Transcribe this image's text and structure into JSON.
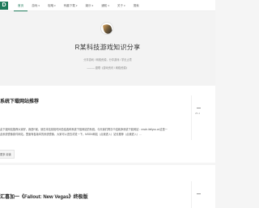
{
  "nav": {
    "logo": "D",
    "items": [
      {
        "label": "首页",
        "active": true
      },
      {
        "label": "游戏",
        "dropdown": true
      },
      {
        "label": "攻略",
        "dropdown": true
      },
      {
        "label": "有趣下载",
        "dropdown": true
      },
      {
        "label": "娱乐",
        "dropdown": true
      },
      {
        "label": "通知",
        "dropdown": true
      },
      {
        "label": "关于",
        "dropdown": true
      },
      {
        "label": "搜索"
      }
    ]
  },
  "hero": {
    "title": "R某科技游戏知识分享",
    "description": "分享游戏 / 网络资源，分享游戏 / 学无止境",
    "subtitle": "——— 题联《游戏资讯 / 网络资源》"
  },
  "articles": [
    {
      "title": "系统下载网站推荐",
      "excerpt_line1": "此下载网站推荐大家好，我是R某，就在本站前段时间总结各种系统下载网站的系统，今天我们再次介绍纯净系统下载网站：msdn.itellyou.cn这是一",
      "excerpt_line2": "此系统镜像原件网站，里面有各版本的系统镜像，大家可以进去浏览一下。MSDN网站（点我进入）站长推荐（点我进入）...",
      "read_more": "更多 阅读",
      "side_dash": "—",
      "side_meta": "25-4"
    },
    {
      "title": "汇喜加一《Fallout: New Vegas》终极版",
      "side_dash": "—"
    }
  ]
}
